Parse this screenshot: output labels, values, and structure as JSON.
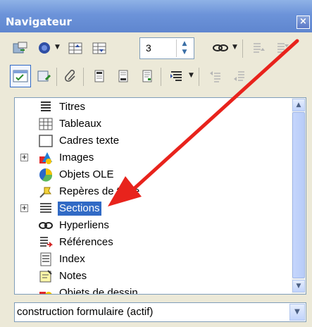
{
  "window": {
    "title": "Navigateur",
    "close_symbol": "×"
  },
  "toolbar1": {
    "spin_value": "3",
    "items": [
      {
        "name": "toggle-icon"
      },
      {
        "name": "navigation-icon"
      },
      {
        "name": "previous-icon"
      },
      {
        "name": "next-icon"
      },
      {
        "name": "drag-mode-icon"
      },
      {
        "name": "promote-level-icon"
      },
      {
        "name": "demote-level-icon"
      }
    ]
  },
  "toolbar2": {
    "items": [
      {
        "name": "content-view-icon"
      },
      {
        "name": "set-reminder-icon"
      },
      {
        "name": "anchor-icon"
      },
      {
        "name": "header-icon"
      },
      {
        "name": "footer-icon"
      },
      {
        "name": "anchor-footnote-icon"
      },
      {
        "name": "heading-levels-icon"
      },
      {
        "name": "promote-chapter-icon"
      },
      {
        "name": "demote-chapter-icon"
      }
    ]
  },
  "tree": {
    "items": [
      {
        "label": "Titres",
        "icon": "headings-icon",
        "expandable": false,
        "selected": false
      },
      {
        "label": "Tableaux",
        "icon": "tables-icon",
        "expandable": false,
        "selected": false
      },
      {
        "label": "Cadres texte",
        "icon": "text-frames-icon",
        "expandable": false,
        "selected": false
      },
      {
        "label": "Images",
        "icon": "images-icon",
        "expandable": true,
        "selected": false
      },
      {
        "label": "Objets OLE",
        "icon": "ole-objects-icon",
        "expandable": false,
        "selected": false
      },
      {
        "label": "Repères de texte",
        "icon": "bookmarks-icon",
        "expandable": false,
        "selected": false
      },
      {
        "label": "Sections",
        "icon": "sections-icon",
        "expandable": true,
        "selected": true
      },
      {
        "label": "Hyperliens",
        "icon": "hyperlinks-icon",
        "expandable": false,
        "selected": false
      },
      {
        "label": "Références",
        "icon": "references-icon",
        "expandable": false,
        "selected": false
      },
      {
        "label": "Index",
        "icon": "indexes-icon",
        "expandable": false,
        "selected": false
      },
      {
        "label": "Notes",
        "icon": "notes-icon",
        "expandable": false,
        "selected": false
      },
      {
        "label": "Objets de dessin",
        "icon": "drawing-objects-icon",
        "expandable": false,
        "selected": false
      }
    ],
    "expand_symbol": "+"
  },
  "scrollbar": {
    "up_symbol": "▲",
    "down_symbol": "▼"
  },
  "document_selector": {
    "value": "construction formulaire (actif)",
    "arrow_symbol": "▼"
  },
  "colors": {
    "selection": "#316ac5",
    "annotation_arrow": "#e8231c",
    "titlebar": "#6c93d9"
  }
}
